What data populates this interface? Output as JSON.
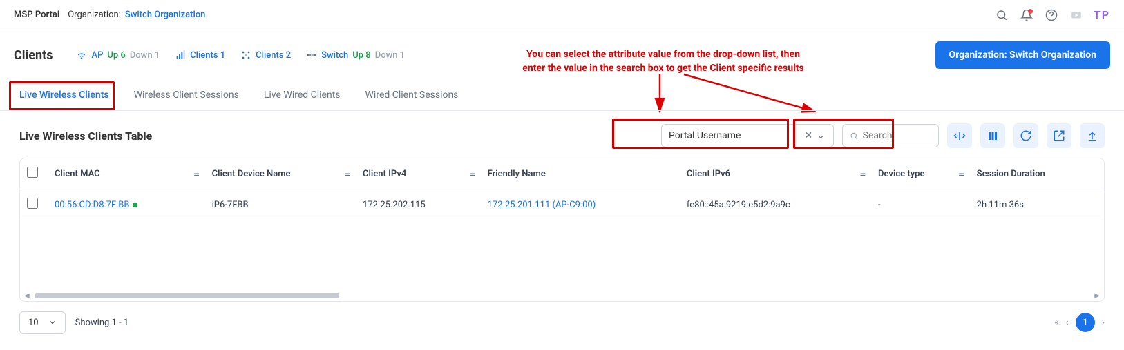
{
  "header": {
    "portal": "MSP Portal",
    "org_label": "Organization:",
    "switch_org": "Switch Organization",
    "avatar": "TP"
  },
  "page": {
    "title": "Clients"
  },
  "stats": {
    "ap": {
      "icon": "wifi",
      "label": "AP",
      "up": "Up 6",
      "down": "Down 1"
    },
    "clients1": {
      "icon": "signal",
      "label": "Clients 1"
    },
    "clients2": {
      "icon": "nodes",
      "label": "Clients 2"
    },
    "switch": {
      "icon": "switch",
      "label": "Switch",
      "up": "Up 8",
      "down": "Down 1"
    }
  },
  "org_button": "Organization: Switch Organization",
  "annotation": {
    "line1": "You can select the attribute value from the drop-down list, then",
    "line2": "enter the value in the search box to get the Client specific results"
  },
  "tabs": [
    "Live Wireless Clients",
    "Wireless Client Sessions",
    "Live Wired Clients",
    "Wired Client Sessions"
  ],
  "table": {
    "title": "Live Wireless Clients Table",
    "attr_selected": "Portal Username",
    "search_placeholder": "Search",
    "columns": [
      "Client MAC",
      "Client Device Name",
      "Client IPv4",
      "Friendly Name",
      "Client IPv6",
      "Device type",
      "Session Duration"
    ],
    "rows": [
      {
        "mac": "00:56:CD:D8:7F:BB",
        "device_name": "iP6-7FBB",
        "ipv4": "172.25.202.115",
        "friendly": "172.25.201.111 (AP-C9:00)",
        "ipv6": "fe80::45a:9219:e5d2:9a9c",
        "device_type": "-",
        "session": "2h 11m 36s"
      }
    ]
  },
  "pagination": {
    "size": "10",
    "showing": "Showing 1 - 1",
    "current": "1"
  }
}
